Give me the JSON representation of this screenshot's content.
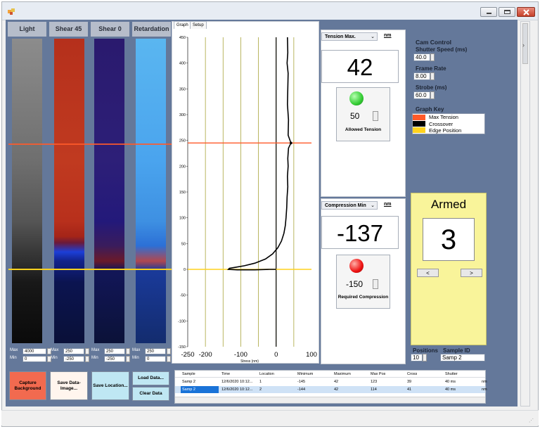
{
  "columns": [
    {
      "title": "Light",
      "max_label": "Max",
      "min_label": "Min",
      "max": "4000",
      "min": "0"
    },
    {
      "title": "Shear 45",
      "max_label": "Max",
      "min_label": "Min",
      "max": "250",
      "min": "-250"
    },
    {
      "title": "Shear 0",
      "max_label": "Max",
      "min_label": "Min",
      "max": "250",
      "min": "-250"
    },
    {
      "title": "Retardation",
      "max_label": "Max",
      "min_label": "Min",
      "max": "250",
      "min": "0"
    }
  ],
  "buttons": {
    "capture_background": "Capture Background",
    "save_data_image": "Save Data-Image...",
    "save_location": "Save Location...",
    "load_data": "Load Data...",
    "clear_data": "Clear Data"
  },
  "tabs": [
    "Graph",
    "Setup"
  ],
  "graph": {
    "y_ticks": [
      "450",
      "400",
      "350",
      "300",
      "250",
      "200",
      "150",
      "100",
      "50",
      "0",
      "-50",
      "-100",
      "-150"
    ],
    "x_ticks": [
      "-250",
      "-200",
      "-100",
      "0",
      "100"
    ],
    "x_label": "Stress (nm)",
    "ylim": [
      -150,
      450
    ],
    "xlim": [
      -250,
      100
    ]
  },
  "tension": {
    "mode": "Tension Max.",
    "unit": "nm",
    "value": "42",
    "limit": "50",
    "label": "Allowed Tension",
    "light_color": "#33cc33"
  },
  "compression": {
    "mode": "Compression Min",
    "unit": "nm",
    "value": "-137",
    "limit": "-150",
    "label": "Required Compression",
    "light_color": "#ee1111"
  },
  "cam_control": {
    "title": "Cam Control",
    "shutter_label": "Shutter Speed (ms)",
    "shutter": "40.0",
    "frame_label": "Frame Rate",
    "frame": "8.00",
    "strobe_label": "Strobe (ms)",
    "strobe": "60.0"
  },
  "graph_key": {
    "title": "Graph Key",
    "items": [
      {
        "label": "Max Tension",
        "color": "#ff5a2a"
      },
      {
        "label": "Crossover",
        "color": "#000000"
      },
      {
        "label": "Edge Position",
        "color": "#ffd21e"
      }
    ]
  },
  "armed": {
    "title": "Armed",
    "count": "3",
    "prev": "<",
    "next": ">"
  },
  "positions": {
    "label": "Positions",
    "value": "10"
  },
  "sample_id": {
    "label": "Sample ID",
    "value": "Samp 2"
  },
  "table": {
    "headers": [
      "Sample",
      "Time",
      "Location",
      "Minimum",
      "Maximum",
      "Max Pos",
      "Cross",
      "Shutter",
      ""
    ],
    "rows": [
      [
        "Samp 2",
        "12/6/2020 10:12...",
        "1",
        "-145",
        "42",
        "123",
        "39",
        "40 ms",
        "nm"
      ],
      [
        "Samp 2",
        "12/6/2020 10:12...",
        "2",
        "-144",
        "42",
        "114",
        "41",
        "40 ms",
        "nm"
      ]
    ]
  }
}
